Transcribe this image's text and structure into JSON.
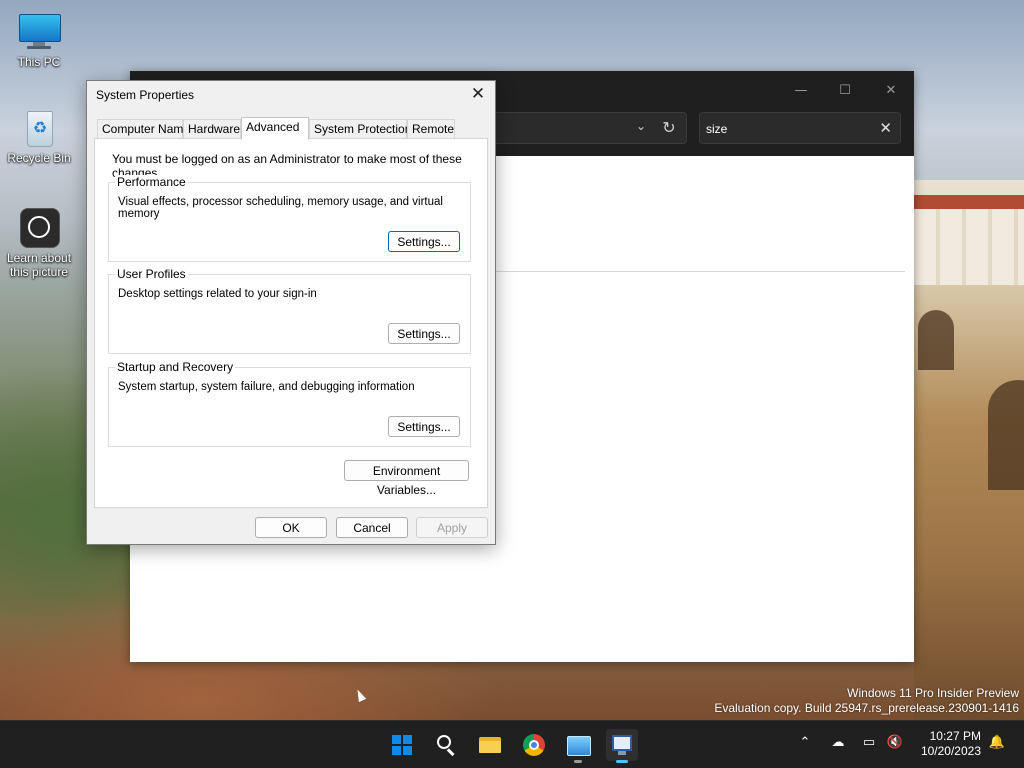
{
  "desktop": {
    "icons": [
      {
        "label": "This PC",
        "icon": "computer-icon"
      },
      {
        "label": "Recycle Bin",
        "icon": "recycle-bin-icon"
      },
      {
        "label": "Learn about\nthis picture",
        "icon": "learn-picture-icon"
      }
    ],
    "watermark": {
      "line1": "Windows 11 Pro Insider Preview",
      "line2": "Evaluation copy. Build 25947.rs_prerelease.230901-1416"
    }
  },
  "background_window": {
    "search_value": "size",
    "controls": {
      "minimize": "—",
      "maximize": "☐",
      "close": "✕"
    },
    "refresh_glyph": "↻",
    "clear_glyph": "✕",
    "chevron_glyph": "⌄"
  },
  "dialog": {
    "title": "System Properties",
    "close_glyph": "✕",
    "tabs": [
      {
        "label": "Computer Name"
      },
      {
        "label": "Hardware"
      },
      {
        "label": "Advanced",
        "active": true
      },
      {
        "label": "System Protection"
      },
      {
        "label": "Remote"
      }
    ],
    "admin_note": "You must be logged on as an Administrator to make most of these changes.",
    "groups": [
      {
        "title": "Performance",
        "description": "Visual effects, processor scheduling, memory usage, and virtual memory",
        "button": "Settings..."
      },
      {
        "title": "User Profiles",
        "description": "Desktop settings related to your sign-in",
        "button": "Settings..."
      },
      {
        "title": "Startup and Recovery",
        "description": "System startup, system failure, and debugging information",
        "button": "Settings..."
      }
    ],
    "env_button": "Environment Variables...",
    "ok": "OK",
    "cancel": "Cancel",
    "apply": "Apply"
  },
  "taskbar": {
    "apps": [
      "start-icon",
      "search-icon",
      "file-explorer-icon",
      "chrome-icon",
      "control-panel-icon",
      "system-properties-icon"
    ],
    "tray": {
      "chevron_glyph": "⌃",
      "time": "10:27 PM",
      "date": "10/20/2023"
    }
  },
  "colors": {
    "accent": "#0067c0",
    "taskbar": "#202020",
    "dark_titlebar": "#1f1f1f"
  }
}
